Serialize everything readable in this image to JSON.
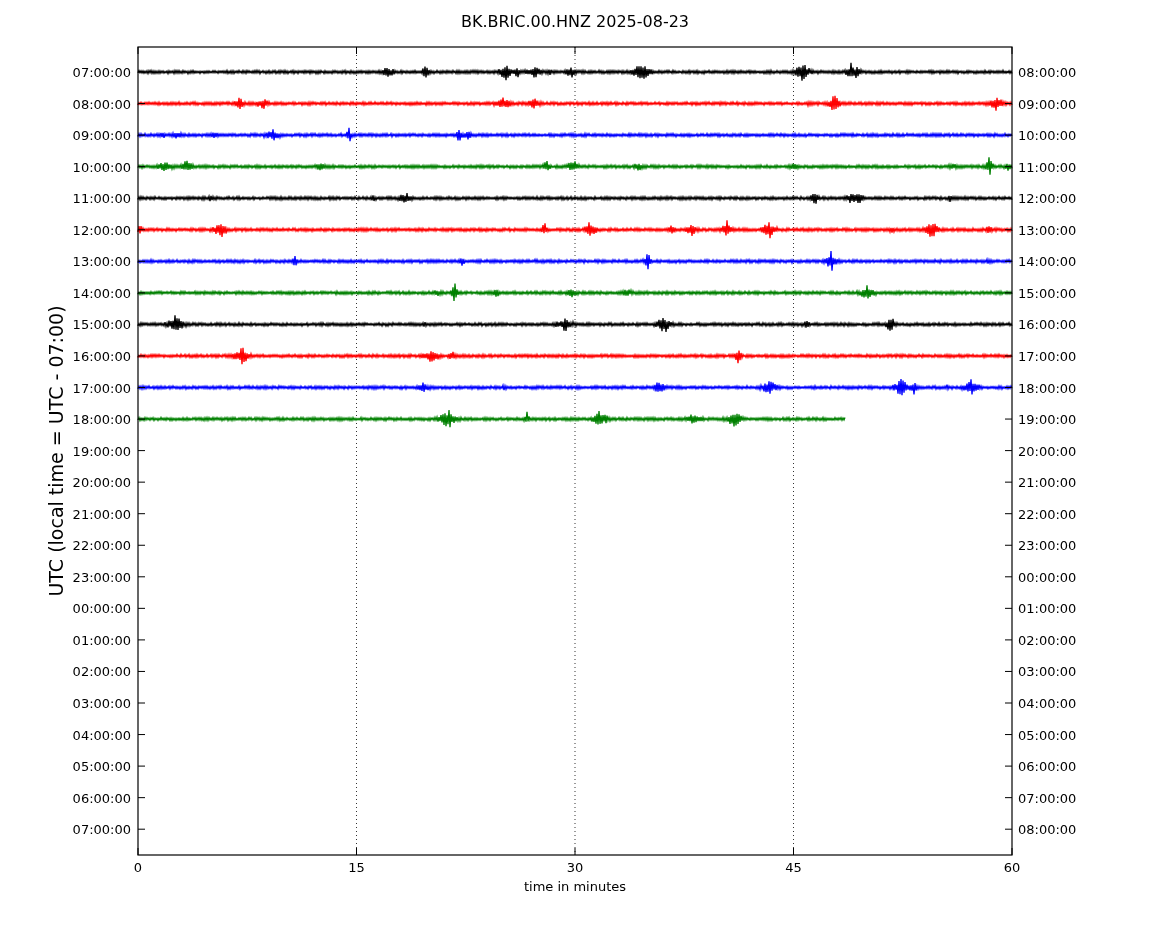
{
  "title": "BK.BRIC.00.HNZ 2025-08-23",
  "ylabel": "UTC (local time = UTC - 07:00)",
  "xlabel": "time in minutes",
  "xticks": [
    "0",
    "15",
    "30",
    "45",
    "60"
  ],
  "rows": [
    {
      "left": "07:00:00",
      "right": "08:00:00"
    },
    {
      "left": "08:00:00",
      "right": "09:00:00"
    },
    {
      "left": "09:00:00",
      "right": "10:00:00"
    },
    {
      "left": "10:00:00",
      "right": "11:00:00"
    },
    {
      "left": "11:00:00",
      "right": "12:00:00"
    },
    {
      "left": "12:00:00",
      "right": "13:00:00"
    },
    {
      "left": "13:00:00",
      "right": "14:00:00"
    },
    {
      "left": "14:00:00",
      "right": "15:00:00"
    },
    {
      "left": "15:00:00",
      "right": "16:00:00"
    },
    {
      "left": "16:00:00",
      "right": "17:00:00"
    },
    {
      "left": "17:00:00",
      "right": "18:00:00"
    },
    {
      "left": "18:00:00",
      "right": "19:00:00"
    },
    {
      "left": "19:00:00",
      "right": "20:00:00"
    },
    {
      "left": "20:00:00",
      "right": "21:00:00"
    },
    {
      "left": "21:00:00",
      "right": "22:00:00"
    },
    {
      "left": "22:00:00",
      "right": "23:00:00"
    },
    {
      "left": "23:00:00",
      "right": "00:00:00"
    },
    {
      "left": "00:00:00",
      "right": "01:00:00"
    },
    {
      "left": "01:00:00",
      "right": "02:00:00"
    },
    {
      "left": "02:00:00",
      "right": "03:00:00"
    },
    {
      "left": "03:00:00",
      "right": "04:00:00"
    },
    {
      "left": "04:00:00",
      "right": "05:00:00"
    },
    {
      "left": "05:00:00",
      "right": "06:00:00"
    },
    {
      "left": "06:00:00",
      "right": "07:00:00"
    },
    {
      "left": "07:00:00",
      "right": "08:00:00"
    }
  ],
  "traces": [
    {
      "color": "#000000",
      "level": 1
    },
    {
      "color": "#ff0000",
      "level": 1
    },
    {
      "color": "#0000ff",
      "level": 1
    },
    {
      "color": "#008000",
      "level": 1
    },
    {
      "color": "#000000",
      "level": 1
    },
    {
      "color": "#ff0000",
      "level": 1
    },
    {
      "color": "#0000ff",
      "level": 1
    },
    {
      "color": "#008000",
      "level": 1
    },
    {
      "color": "#000000",
      "level": 1
    },
    {
      "color": "#ff0000",
      "level": 1
    },
    {
      "color": "#0000ff",
      "level": 1
    },
    {
      "color": "#008000",
      "level": 0.81
    }
  ]
}
